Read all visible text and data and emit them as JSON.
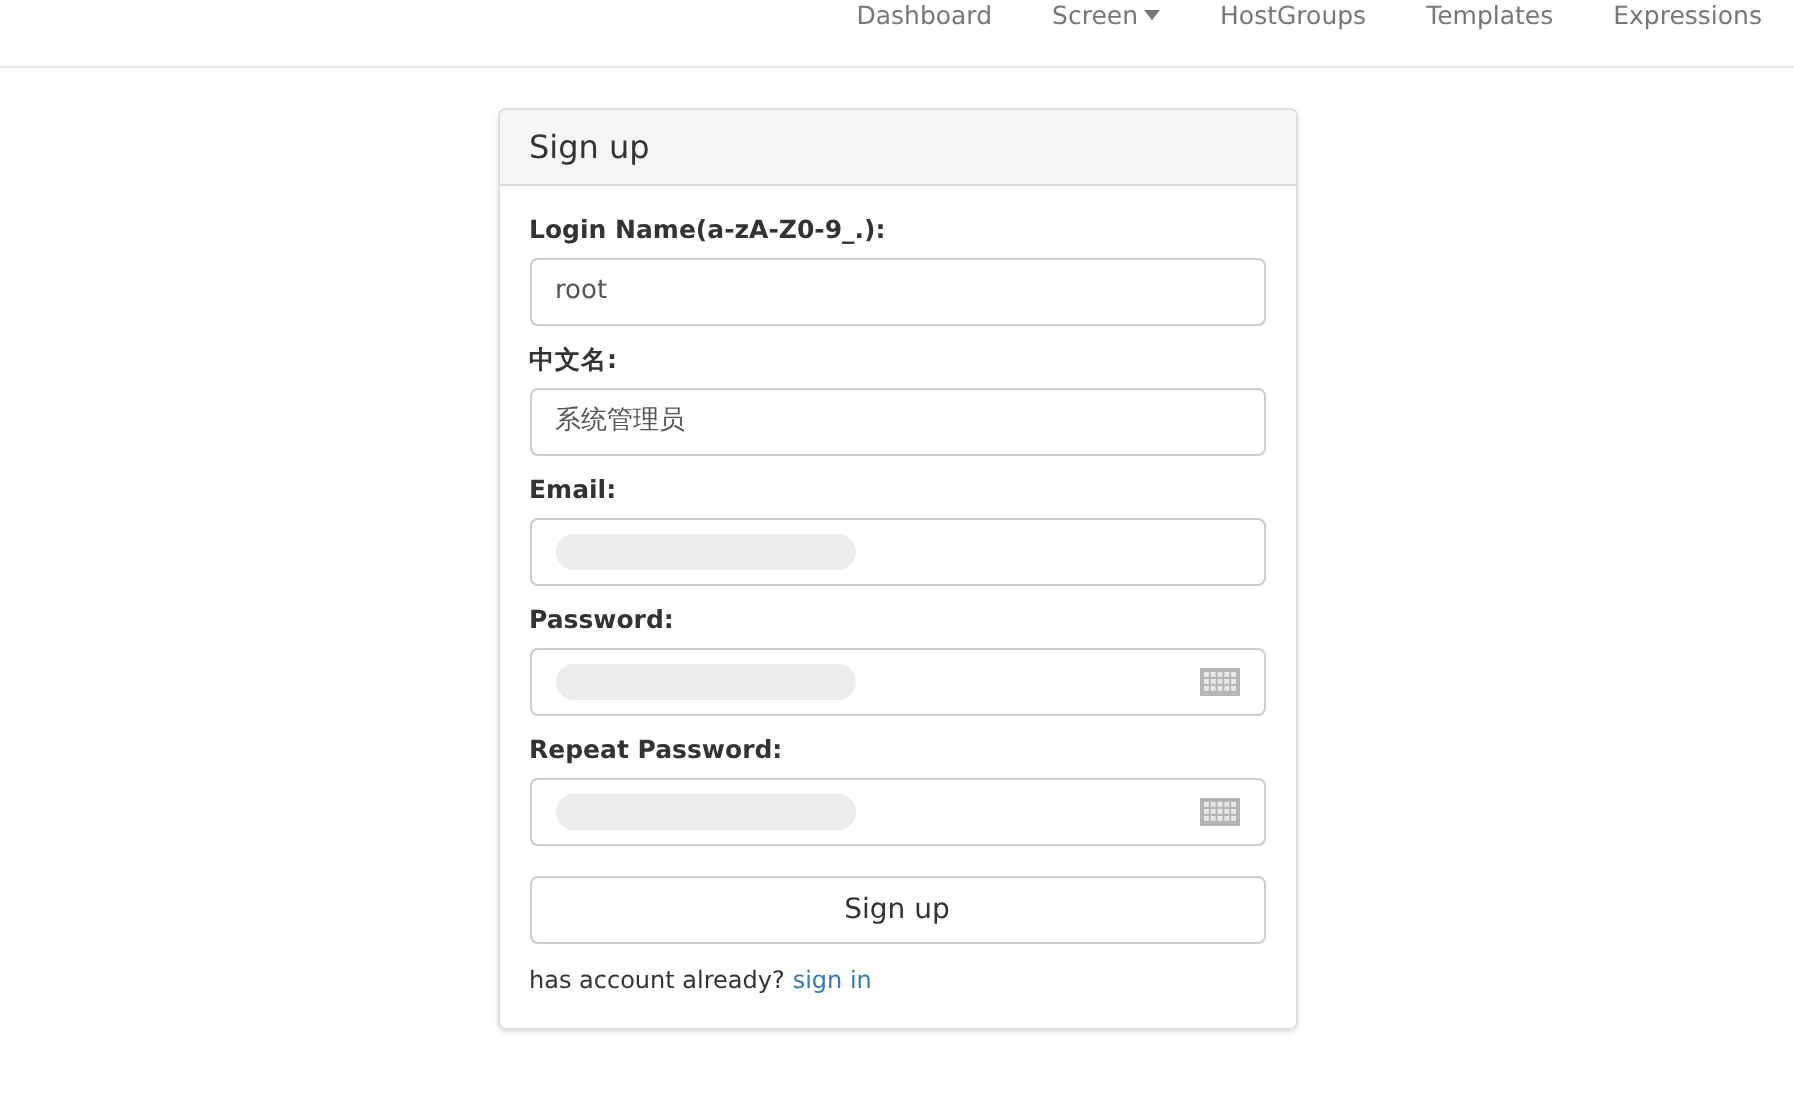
{
  "nav": [
    {
      "label": "Dashboard",
      "dropdown": false
    },
    {
      "label": "Screen",
      "dropdown": true
    },
    {
      "label": "HostGroups",
      "dropdown": false
    },
    {
      "label": "Templates",
      "dropdown": false
    },
    {
      "label": "Expressions",
      "dropdown": false
    }
  ],
  "panel": {
    "title": "Sign up",
    "fields": [
      {
        "label": "Login Name(a-zA-Z0-9_.):",
        "value": "root",
        "redacted": false,
        "keyboard_icon": false
      },
      {
        "label": "中文名:",
        "value": "系统管理员",
        "redacted": false,
        "keyboard_icon": false
      },
      {
        "label": "Email:",
        "redacted": true,
        "keyboard_icon": false
      },
      {
        "label": "Password:",
        "redacted": true,
        "keyboard_icon": true
      },
      {
        "label": "Repeat Password:",
        "redacted": true,
        "keyboard_icon": true
      }
    ],
    "button": "Sign up",
    "footer": {
      "text": "has account already?",
      "link": "sign in"
    }
  }
}
